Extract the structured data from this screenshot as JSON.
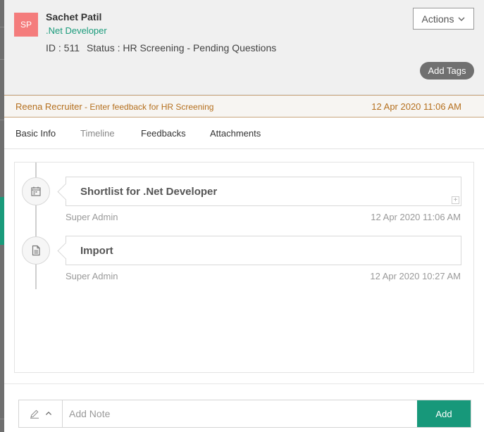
{
  "candidate": {
    "initials": "SP",
    "name": "Sachet Patil",
    "role": ".Net Developer",
    "id_text": "ID : 511",
    "status_text": "Status : HR Screening - Pending Questions",
    "avatar_color": "#f47c7c"
  },
  "header": {
    "actions_label": "Actions",
    "add_tags_label": "Add Tags"
  },
  "feedback": {
    "recruiter": "Reena Recruiter",
    "prompt": " - Enter feedback for HR Screening",
    "datetime": "12 Apr 2020 11:06 AM"
  },
  "tabs": [
    {
      "label": "Basic Info"
    },
    {
      "label": "Timeline"
    },
    {
      "label": "Feedbacks"
    },
    {
      "label": "Attachments"
    }
  ],
  "timeline": [
    {
      "icon": "calendar-icon",
      "title": "Shortlist for .Net Developer",
      "by": "Super Admin",
      "datetime": "12 Apr 2020 11:06 AM"
    },
    {
      "icon": "document-icon",
      "title": "Import",
      "by": "Super Admin",
      "datetime": "12 Apr 2020 10:27 AM"
    }
  ],
  "note": {
    "placeholder": "Add Note",
    "add_label": "Add"
  },
  "colors": {
    "accent": "#17987a",
    "feedback_text": "#b5701f"
  }
}
